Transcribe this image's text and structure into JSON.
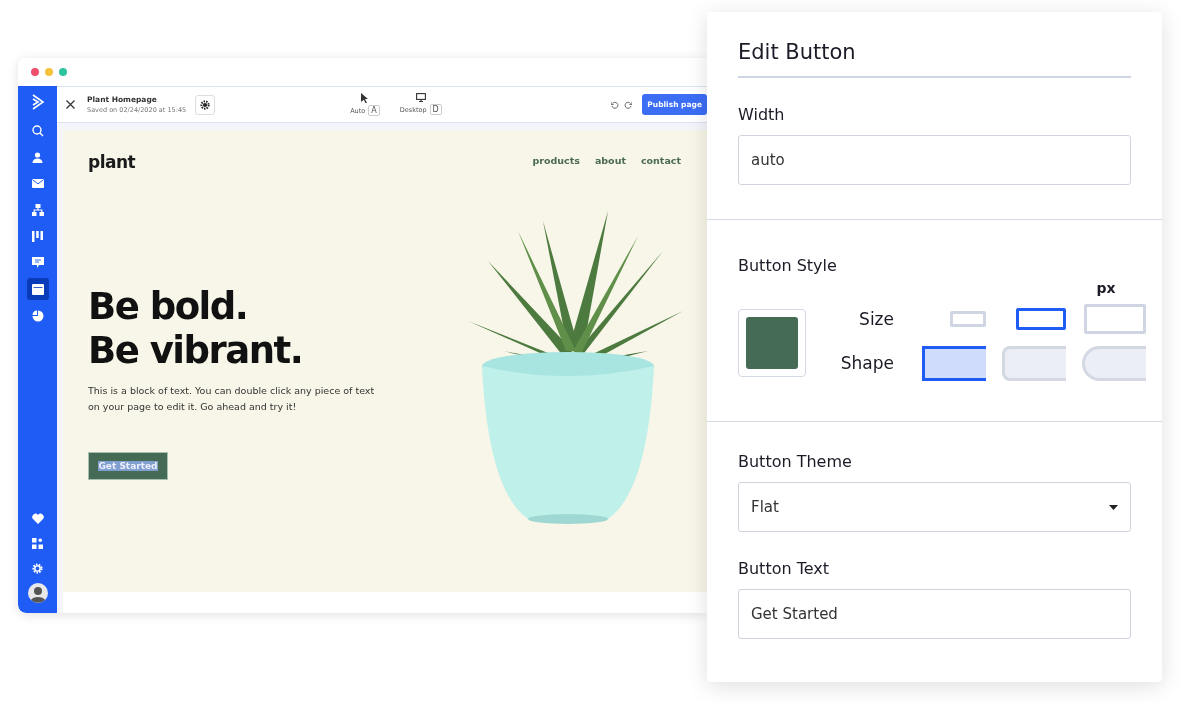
{
  "window": {
    "dots": [
      {
        "color": "#f0506e"
      },
      {
        "color": "#f5c33b"
      },
      {
        "color": "#2ec4a0"
      }
    ]
  },
  "sidebar": {
    "items": [
      {
        "kind": "search",
        "selected": false
      },
      {
        "kind": "person",
        "selected": false
      },
      {
        "kind": "mail",
        "selected": false
      },
      {
        "kind": "sitemap",
        "selected": false
      },
      {
        "kind": "board",
        "selected": false
      },
      {
        "kind": "chat",
        "selected": false
      },
      {
        "kind": "page",
        "selected": true
      },
      {
        "kind": "pie",
        "selected": false
      }
    ],
    "bottom_items": [
      {
        "kind": "heart"
      },
      {
        "kind": "apps"
      },
      {
        "kind": "gear"
      },
      {
        "kind": "avatar"
      }
    ]
  },
  "toolbar": {
    "title": "Plant Homepage",
    "saved": "Saved on 02/24/2020 at 15:45",
    "modes": [
      {
        "kind": "cursor",
        "label": "Auto",
        "key": "A"
      },
      {
        "kind": "desktop",
        "label": "Desktop",
        "key": "D"
      }
    ],
    "publish": "Publish page"
  },
  "site": {
    "logo": "plant",
    "nav": [
      "products",
      "about",
      "contact"
    ],
    "headline": [
      "Be bold.",
      "Be vibrant."
    ],
    "body": "This is a block of text. You can double click any piece of text on your page to edit it. Go ahead and try it!",
    "cta": {
      "label": "Get Started",
      "text_selected": true
    }
  },
  "panel": {
    "title": "Edit Button",
    "width": {
      "label": "Width",
      "value": "auto"
    },
    "style": {
      "label": "Button Style",
      "color": "#456b55",
      "unit": "px",
      "size_label": "Size",
      "sizes": [
        {
          "kind": "small",
          "selected": false
        },
        {
          "kind": "medium",
          "selected": true
        },
        {
          "kind": "large",
          "selected": false
        }
      ],
      "shape_label": "Shape",
      "shapes": [
        {
          "kind": "square",
          "selected": true
        },
        {
          "kind": "rounded",
          "selected": false
        },
        {
          "kind": "pill",
          "selected": false
        }
      ]
    },
    "theme": {
      "label": "Button Theme",
      "value": "Flat"
    },
    "text": {
      "label": "Button Text",
      "value": "Get Started"
    }
  }
}
